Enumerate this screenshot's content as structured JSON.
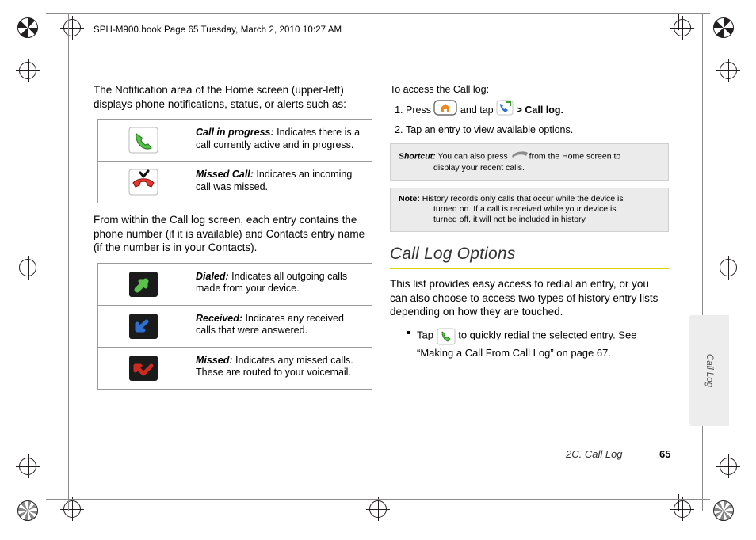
{
  "header": {
    "text": "SPH-M900.book  Page 65  Tuesday, March 2, 2010  10:27 AM"
  },
  "left_column": {
    "intro": "The Notification area of the Home screen (upper-left) displays phone notifications, status, or alerts such as:",
    "table_one": [
      {
        "icon": "call-in-progress-icon",
        "term": "Call in progress:",
        "desc": " Indicates there is a call currently active and in progress."
      },
      {
        "icon": "missed-call-icon",
        "term": "Missed Call:",
        "desc": " Indicates an incoming call was missed."
      }
    ],
    "middle_text": "From within the Call log screen, each entry contains the phone number (if it is available) and Contacts entry name (if the number is in your Contacts).",
    "table_two": [
      {
        "icon": "dialed-call-icon",
        "term": "Dialed:",
        "desc": " Indicates all outgoing calls made from your device."
      },
      {
        "icon": "received-call-icon",
        "term": "Received:",
        "desc": " Indicates any received calls that were answered."
      },
      {
        "icon": "missed-call-list-icon",
        "term": "Missed:",
        "desc": " Indicates any missed calls. These are routed to your voicemail."
      }
    ]
  },
  "right_column": {
    "intro": "To access the Call log:",
    "steps": [
      {
        "num": "1.",
        "pre": "Press",
        "mid": "and tap",
        "post": "> Call log."
      },
      {
        "num": "2.",
        "text": "Tap an entry to view available options."
      }
    ],
    "shortcut": {
      "label": "Shortcut:",
      "text": " You can also press",
      "text2": "from the Home screen to",
      "text3": "display your recent calls."
    },
    "note": {
      "label": "Note:",
      "text": "  History records only calls that occur while the device is",
      "text2": "turned on. If a call is received while your device is",
      "text3": "turned off, it will not be included in history."
    },
    "section_title": "Call Log Options",
    "section_rule_color": "#d8d400",
    "paragraph": "This list provides easy access to redial an entry, or you can also choose to access two types of history entry lists depending on how they are touched.",
    "bullets": [
      {
        "pre": "Tap",
        "icon": "green-phone-icon",
        "post": "to quickly redial the selected entry. See “Making a Call From Call Log” on page 67."
      }
    ]
  },
  "thumb_tab": {
    "label": "Call Log"
  },
  "footer": {
    "title": "2C. Call Log",
    "page": "65"
  }
}
